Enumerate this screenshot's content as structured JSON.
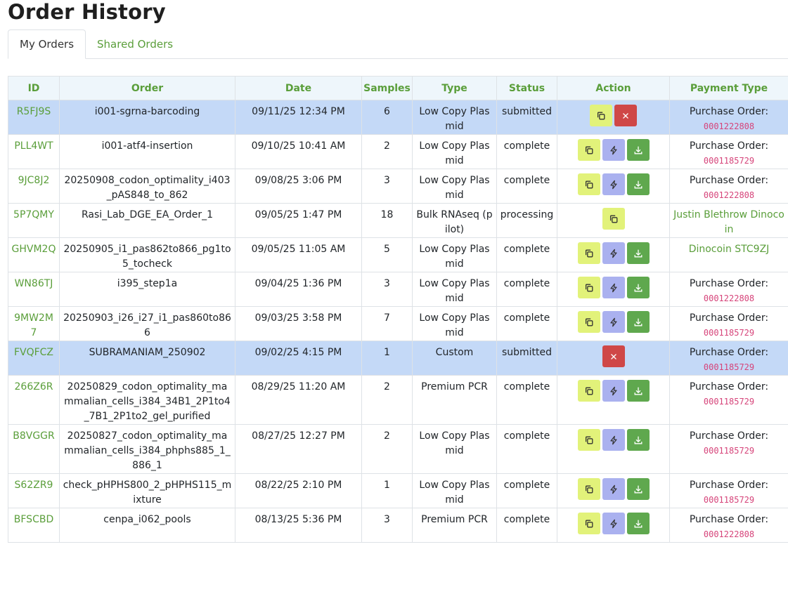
{
  "page": {
    "title": "Order History"
  },
  "tabs": [
    {
      "label": "My Orders",
      "active": true
    },
    {
      "label": "Shared Orders",
      "active": false
    }
  ],
  "table": {
    "headers": [
      "ID",
      "Order",
      "Date",
      "Samples",
      "Type",
      "Status",
      "Action",
      "Payment Type"
    ],
    "rows": [
      {
        "id": "R5FJ9S",
        "order": "i001-sgrna-barcoding",
        "date": "09/11/25 12:34 PM",
        "samples": "6",
        "type": "Low Copy Plasmid",
        "status": "submitted",
        "actions": [
          "copy",
          "delete"
        ],
        "payment": {
          "label": "Purchase Order:",
          "code": "0001222808"
        },
        "highlight": true
      },
      {
        "id": "PLL4WT",
        "order": "i001-atf4-insertion",
        "date": "09/10/25 10:41 AM",
        "samples": "2",
        "type": "Low Copy Plasmid",
        "status": "complete",
        "actions": [
          "copy",
          "bolt",
          "download"
        ],
        "payment": {
          "label": "Purchase Order:",
          "code": "0001185729"
        },
        "highlight": false
      },
      {
        "id": "9JC8J2",
        "order": "20250908_codon_optimality_i403_pAS848_to_862",
        "date": "09/08/25 3:06 PM",
        "samples": "3",
        "type": "Low Copy Plasmid",
        "status": "complete",
        "actions": [
          "copy",
          "bolt",
          "download"
        ],
        "payment": {
          "label": "Purchase Order:",
          "code": "0001222808"
        },
        "highlight": false
      },
      {
        "id": "5P7QMY",
        "order": "Rasi_Lab_DGE_EA_Order_1",
        "date": "09/05/25 1:47 PM",
        "samples": "18",
        "type": "Bulk RNAseq (pilot)",
        "status": "processing",
        "actions": [
          "copy"
        ],
        "payment": {
          "link": "Justin Blethrow Dinocoin"
        },
        "highlight": false
      },
      {
        "id": "GHVM2Q",
        "order": "20250905_i1_pas862to866_pg1to5_tocheck",
        "date": "09/05/25 11:05 AM",
        "samples": "5",
        "type": "Low Copy Plasmid",
        "status": "complete",
        "actions": [
          "copy",
          "bolt",
          "download"
        ],
        "payment": {
          "link": "Dinocoin STC9ZJ"
        },
        "highlight": false
      },
      {
        "id": "WN86TJ",
        "order": "i395_step1a",
        "date": "09/04/25 1:36 PM",
        "samples": "3",
        "type": "Low Copy Plasmid",
        "status": "complete",
        "actions": [
          "copy",
          "bolt",
          "download"
        ],
        "payment": {
          "label": "Purchase Order:",
          "code": "0001222808"
        },
        "highlight": false
      },
      {
        "id": "9MW2M7",
        "order": "20250903_i26_i27_i1_pas860to866",
        "date": "09/03/25 3:58 PM",
        "samples": "7",
        "type": "Low Copy Plasmid",
        "status": "complete",
        "actions": [
          "copy",
          "bolt",
          "download"
        ],
        "payment": {
          "label": "Purchase Order:",
          "code": "0001185729"
        },
        "highlight": false
      },
      {
        "id": "FVQFCZ",
        "order": "SUBRAMANIAM_250902",
        "date": "09/02/25 4:15 PM",
        "samples": "1",
        "type": "Custom",
        "status": "submitted",
        "actions": [
          "delete"
        ],
        "payment": {
          "label": "Purchase Order:",
          "code": "0001185729"
        },
        "highlight": true
      },
      {
        "id": "266Z6R",
        "order": "20250829_codon_optimality_mammalian_cells_i384_34B1_2P1to4_7B1_2P1to2_gel_purified",
        "date": "08/29/25 11:20 AM",
        "samples": "2",
        "type": "Premium PCR",
        "status": "complete",
        "actions": [
          "copy",
          "bolt",
          "download"
        ],
        "payment": {
          "label": "Purchase Order:",
          "code": "0001185729"
        },
        "highlight": false
      },
      {
        "id": "B8VGGR",
        "order": "20250827_codon_optimality_mammalian_cells_i384_phphs885_1_886_1",
        "date": "08/27/25 12:27 PM",
        "samples": "2",
        "type": "Low Copy Plasmid",
        "status": "complete",
        "actions": [
          "copy",
          "bolt",
          "download"
        ],
        "payment": {
          "label": "Purchase Order:",
          "code": "0001185729"
        },
        "highlight": false
      },
      {
        "id": "S62ZR9",
        "order": "check_pHPHS800_2_pHPHS115_mixture",
        "date": "08/22/25 2:10 PM",
        "samples": "1",
        "type": "Low Copy Plasmid",
        "status": "complete",
        "actions": [
          "copy",
          "bolt",
          "download"
        ],
        "payment": {
          "label": "Purchase Order:",
          "code": "0001185729"
        },
        "highlight": false
      },
      {
        "id": "BFSCBD",
        "order": "cenpa_i062_pools",
        "date": "08/13/25 5:36 PM",
        "samples": "3",
        "type": "Premium PCR",
        "status": "complete",
        "actions": [
          "copy",
          "bolt",
          "download"
        ],
        "payment": {
          "label": "Purchase Order:",
          "code": "0001222808"
        },
        "highlight": false
      }
    ]
  },
  "icons": {
    "copy": "copy-icon",
    "bolt": "bolt-icon",
    "download": "download-icon",
    "delete": "close-icon"
  },
  "colors": {
    "accent": "#5a9e3a",
    "highlight": "#c4d9f7",
    "copy": "#e2f27a",
    "bolt": "#aab1ef",
    "download": "#5fa84e",
    "delete": "#cf4747",
    "po_code": "#d6447a"
  }
}
